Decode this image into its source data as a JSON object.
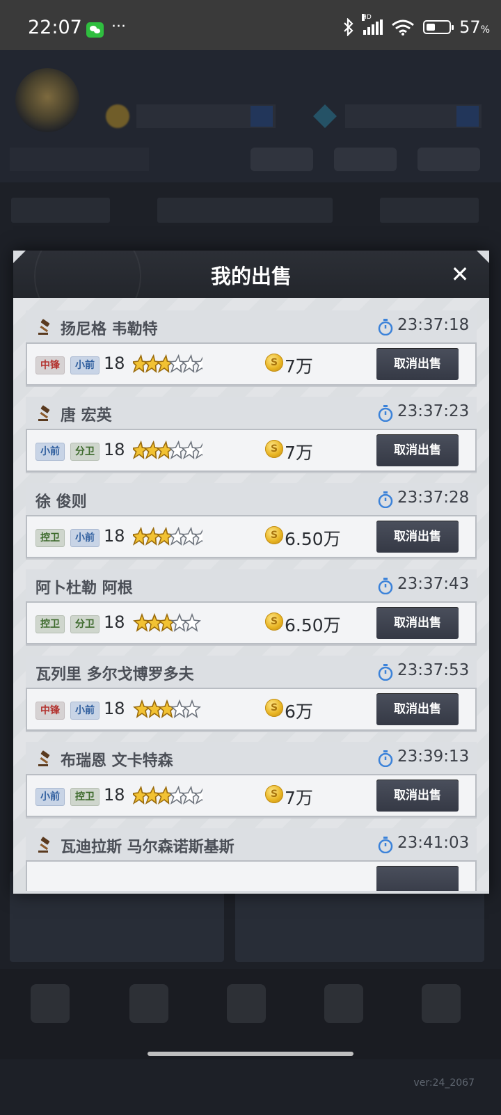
{
  "status_bar": {
    "time": "22:07",
    "more": "···",
    "network": "HD",
    "battery": "57",
    "battery_unit": "%",
    "battery_level": 0.57
  },
  "background": {
    "version": "ver:24_2067"
  },
  "modal": {
    "title": "我的出售",
    "close_icon": "close-icon"
  },
  "listings": [
    {
      "name": "扬尼格 韦勒特",
      "auction": true,
      "time": "23:37:18",
      "tags": [
        {
          "text": "中锋",
          "color": "red"
        },
        {
          "text": "小前",
          "color": "blue"
        }
      ],
      "level": "18",
      "stars": {
        "gold": 3,
        "silver": 3,
        "type": "wing"
      },
      "price": "7万",
      "button": "取消出售"
    },
    {
      "name": "唐 宏英",
      "auction": true,
      "time": "23:37:23",
      "tags": [
        {
          "text": "小前",
          "color": "blue"
        },
        {
          "text": "分卫",
          "color": "green"
        }
      ],
      "level": "18",
      "stars": {
        "gold": 3,
        "silver": 3,
        "type": "wing"
      },
      "price": "7万",
      "button": "取消出售"
    },
    {
      "name": "徐 俊则",
      "auction": false,
      "time": "23:37:28",
      "tags": [
        {
          "text": "控卫",
          "color": "green"
        },
        {
          "text": "小前",
          "color": "blue"
        }
      ],
      "level": "18",
      "stars": {
        "gold": 3,
        "silver": 3,
        "type": "wing"
      },
      "price": "6.50万",
      "button": "取消出售"
    },
    {
      "name": "阿卜杜勒 阿根",
      "auction": false,
      "time": "23:37:43",
      "tags": [
        {
          "text": "控卫",
          "color": "green"
        },
        {
          "text": "分卫",
          "color": "green"
        }
      ],
      "level": "18",
      "stars": {
        "gold": 3,
        "silver": 2,
        "type": "star"
      },
      "price": "6.50万",
      "button": "取消出售"
    },
    {
      "name": "瓦列里 多尔戈博罗多夫",
      "auction": false,
      "time": "23:37:53",
      "tags": [
        {
          "text": "中锋",
          "color": "red"
        },
        {
          "text": "小前",
          "color": "blue"
        }
      ],
      "level": "18",
      "stars": {
        "gold": 3,
        "silver": 2,
        "type": "star"
      },
      "price": "6万",
      "button": "取消出售"
    },
    {
      "name": "布瑞恩 文卡特森",
      "auction": true,
      "time": "23:39:13",
      "tags": [
        {
          "text": "小前",
          "color": "blue"
        },
        {
          "text": "控卫",
          "color": "green"
        }
      ],
      "level": "18",
      "stars": {
        "gold": 3,
        "silver": 3,
        "type": "wing"
      },
      "price": "7万",
      "button": "取消出售"
    },
    {
      "name": "瓦迪拉斯 马尔森诺斯基斯",
      "auction": true,
      "time": "23:41:03",
      "tags": [],
      "level": "",
      "stars": {
        "gold": 0,
        "silver": 0,
        "type": "wing"
      },
      "price": "",
      "button": ""
    }
  ]
}
